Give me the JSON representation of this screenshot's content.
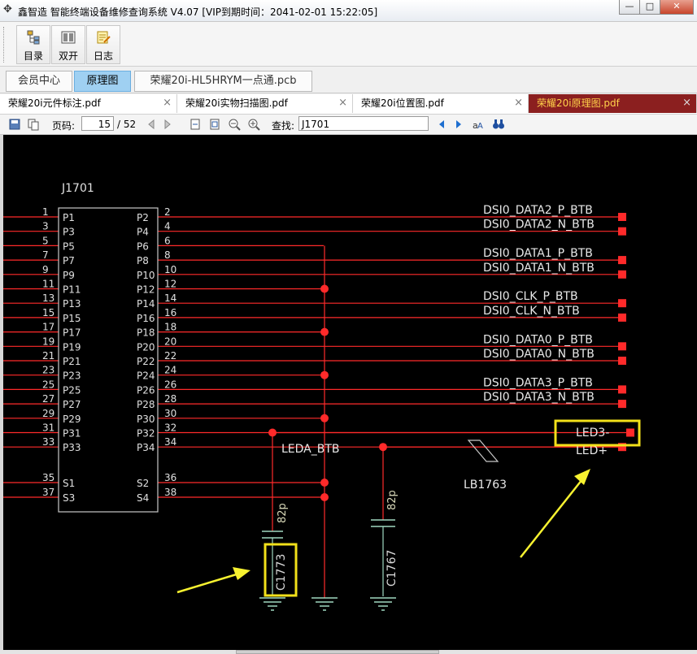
{
  "window": {
    "title": "鑫智造 智能终端设备维修查询系统 V4.07 [VIP到期时间：2041-02-01 15:22:05]",
    "minimize": "—",
    "maximize": "□",
    "close": "✕"
  },
  "toolbar": {
    "buttons": [
      {
        "label": "目录",
        "icon": "directory-icon"
      },
      {
        "label": "双开",
        "icon": "dual-open-icon"
      },
      {
        "label": "日志",
        "icon": "log-icon"
      }
    ]
  },
  "nav_tabs": [
    {
      "label": "会员中心",
      "active": false
    },
    {
      "label": "原理图",
      "active": true
    },
    {
      "label": "荣耀20i-HL5HRYM一点通.pcb",
      "active": false
    }
  ],
  "doc_tabs": [
    {
      "label": "荣耀20i元件标注.pdf",
      "close": "×",
      "active": false
    },
    {
      "label": "荣耀20i实物扫描图.pdf",
      "close": "×",
      "active": false
    },
    {
      "label": "荣耀20i位置图.pdf",
      "close": "×",
      "active": false
    },
    {
      "label": "荣耀20i原理图.pdf",
      "close": "×",
      "active": true
    }
  ],
  "pdf_toolbar": {
    "page_label": "页码:",
    "page_current": "15",
    "page_total": "/ 52",
    "find_label": "查找:",
    "find_value": "J1701"
  },
  "schematic": {
    "connector": "J1701",
    "left_pins": [
      {
        "num": "1",
        "name": "P1"
      },
      {
        "num": "3",
        "name": "P3"
      },
      {
        "num": "5",
        "name": "P5"
      },
      {
        "num": "7",
        "name": "P7"
      },
      {
        "num": "9",
        "name": "P9"
      },
      {
        "num": "11",
        "name": "P11"
      },
      {
        "num": "13",
        "name": "P13"
      },
      {
        "num": "15",
        "name": "P15"
      },
      {
        "num": "17",
        "name": "P17"
      },
      {
        "num": "19",
        "name": "P19"
      },
      {
        "num": "21",
        "name": "P21"
      },
      {
        "num": "23",
        "name": "P23"
      },
      {
        "num": "25",
        "name": "P25"
      },
      {
        "num": "27",
        "name": "P27"
      },
      {
        "num": "29",
        "name": "P29"
      },
      {
        "num": "31",
        "name": "P31"
      },
      {
        "num": "33",
        "name": "P33"
      },
      {
        "num": "35",
        "name": "S1"
      },
      {
        "num": "37",
        "name": "S3"
      }
    ],
    "right_pins": [
      {
        "num": "2",
        "name": "P2"
      },
      {
        "num": "4",
        "name": "P4"
      },
      {
        "num": "6",
        "name": "P6"
      },
      {
        "num": "8",
        "name": "P8"
      },
      {
        "num": "10",
        "name": "P10"
      },
      {
        "num": "12",
        "name": "P12"
      },
      {
        "num": "14",
        "name": "P14"
      },
      {
        "num": "16",
        "name": "P16"
      },
      {
        "num": "18",
        "name": "P18"
      },
      {
        "num": "20",
        "name": "P20"
      },
      {
        "num": "22",
        "name": "P22"
      },
      {
        "num": "24",
        "name": "P24"
      },
      {
        "num": "26",
        "name": "P26"
      },
      {
        "num": "28",
        "name": "P28"
      },
      {
        "num": "30",
        "name": "P30"
      },
      {
        "num": "32",
        "name": "P32"
      },
      {
        "num": "34",
        "name": "P34"
      },
      {
        "num": "36",
        "name": "S2"
      },
      {
        "num": "38",
        "name": "S4"
      }
    ],
    "nets": [
      "DSI0_DATA2_P_BTB",
      "DSI0_DATA2_N_BTB",
      "DSI0_DATA1_P_BTB",
      "DSI0_DATA1_N_BTB",
      "DSI0_CLK_P_BTB",
      "DSI0_CLK_N_BTB",
      "DSI0_DATA0_P_BTB",
      "DSI0_DATA0_N_BTB",
      "DSI0_DATA3_P_BTB",
      "DSI0_DATA3_N_BTB"
    ],
    "leda_net": "LEDA_BTB",
    "led_minus": "LED3-",
    "led_plus": "LED+",
    "inductor": "LB1763",
    "cap1_ref": "C1773",
    "cap1_val": "82p",
    "cap2_ref": "C1767",
    "cap2_val": "82p"
  },
  "colors": {
    "wire": "#ff2a2a",
    "symbol": "#c8c8c8",
    "ground": "#9fd8c0",
    "highlight": "#f2e11a",
    "arrow": "#f7f230"
  }
}
